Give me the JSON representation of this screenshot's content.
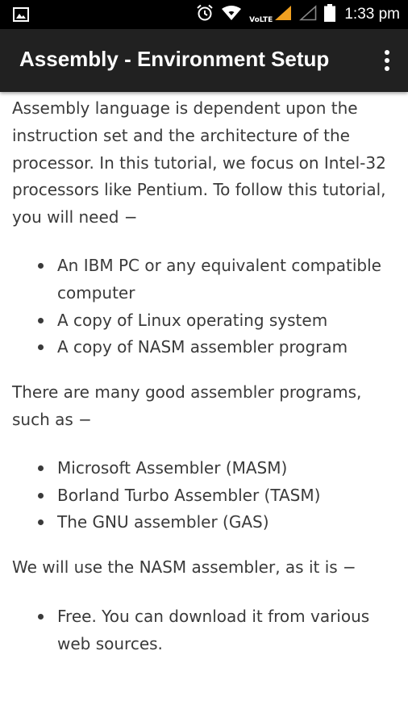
{
  "status_bar": {
    "time": "1:33 pm",
    "network_label": "VoLTE",
    "icons": [
      "image-icon",
      "alarm-icon",
      "wifi-icon",
      "signal-icon",
      "signal-empty-icon",
      "battery-icon"
    ]
  },
  "app_bar": {
    "title": "Assembly - Environment Setup",
    "menu_icon": "more-vert-icon"
  },
  "content": {
    "intro": "Assembly language is dependent upon the instruction set and the architecture of the processor. In this tutorial, we focus on Intel-32 processors like Pentium. To follow this tutorial, you will need −",
    "requirements": [
      "An IBM PC or any equivalent compatible computer",
      "A copy of Linux operating system",
      "A copy of NASM assembler program"
    ],
    "assemblers_intro": "There are many good assembler programs, such as −",
    "assemblers": [
      "Microsoft Assembler (MASM)",
      "Borland Turbo Assembler (TASM)",
      "The GNU assembler (GAS)"
    ],
    "nasm_intro": "We will use the NASM assembler, as it is −",
    "nasm_reasons": [
      "Free. You can download it from various web sources."
    ]
  }
}
